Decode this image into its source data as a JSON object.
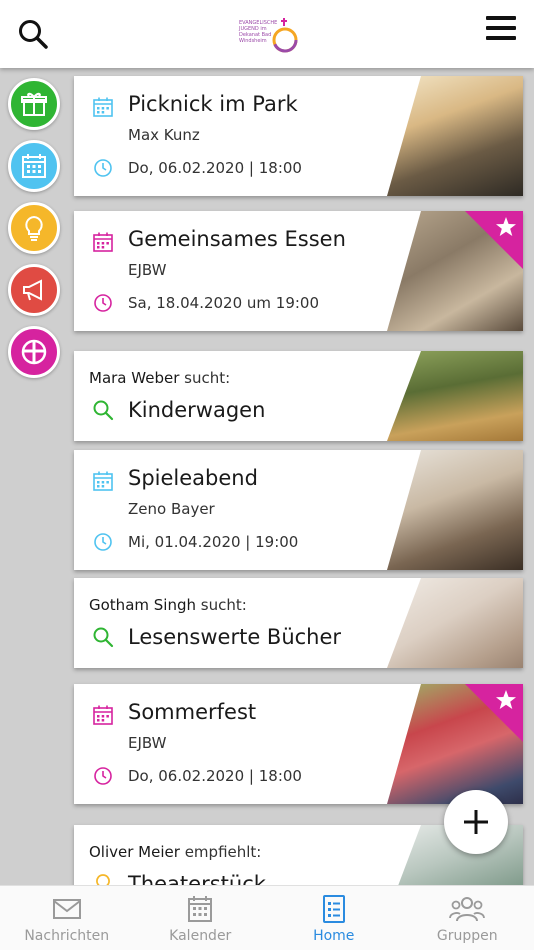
{
  "header": {
    "logo_text": "EVANGELISCHE JUGEND im Dekanat Bad Windsheim"
  },
  "side_actions": [
    {
      "name": "gift",
      "color": "#2fb533"
    },
    {
      "name": "calendar",
      "color": "#4fc3f0"
    },
    {
      "name": "lightbulb",
      "color": "#f5b72a"
    },
    {
      "name": "megaphone",
      "color": "#e04b43"
    },
    {
      "name": "church",
      "color": "#d6239f"
    }
  ],
  "cards": [
    {
      "type": "event",
      "title": "Picknick im Park",
      "organizer": "Max Kunz",
      "date": "Do, 06.02.2020 | 18:00",
      "accent": "#4fc3f0",
      "featured": false
    },
    {
      "type": "event",
      "title": "Gemeinsames Essen",
      "organizer": "EJBW",
      "date": "Sa, 18.04.2020 um 19:00",
      "accent": "#d6239f",
      "featured": true
    },
    {
      "type": "search",
      "person": "Mara Weber",
      "verb": "sucht:",
      "title": "Kinderwagen",
      "accent": "#2fb533"
    },
    {
      "type": "event",
      "title": "Spieleabend",
      "organizer": "Zeno Bayer",
      "date": "Mi, 01.04.2020 | 19:00",
      "accent": "#4fc3f0",
      "featured": false
    },
    {
      "type": "search",
      "person": "Gotham Singh",
      "verb": "sucht:",
      "title": "Lesenswerte Bücher",
      "accent": "#2fb533"
    },
    {
      "type": "event",
      "title": "Sommerfest",
      "organizer": "EJBW",
      "date": "Do, 06.02.2020 | 18:00",
      "accent": "#d6239f",
      "featured": true
    },
    {
      "type": "recommend",
      "person": "Oliver Meier",
      "verb": "empfiehlt:",
      "title": "Theaterstück",
      "accent": "#f5b72a"
    }
  ],
  "bottom_nav": [
    {
      "label": "Nachrichten",
      "icon": "envelope-icon",
      "active": false
    },
    {
      "label": "Kalender",
      "icon": "calendar-icon",
      "active": false
    },
    {
      "label": "Home",
      "icon": "list-icon",
      "active": true
    },
    {
      "label": "Gruppen",
      "icon": "group-icon",
      "active": false
    }
  ]
}
